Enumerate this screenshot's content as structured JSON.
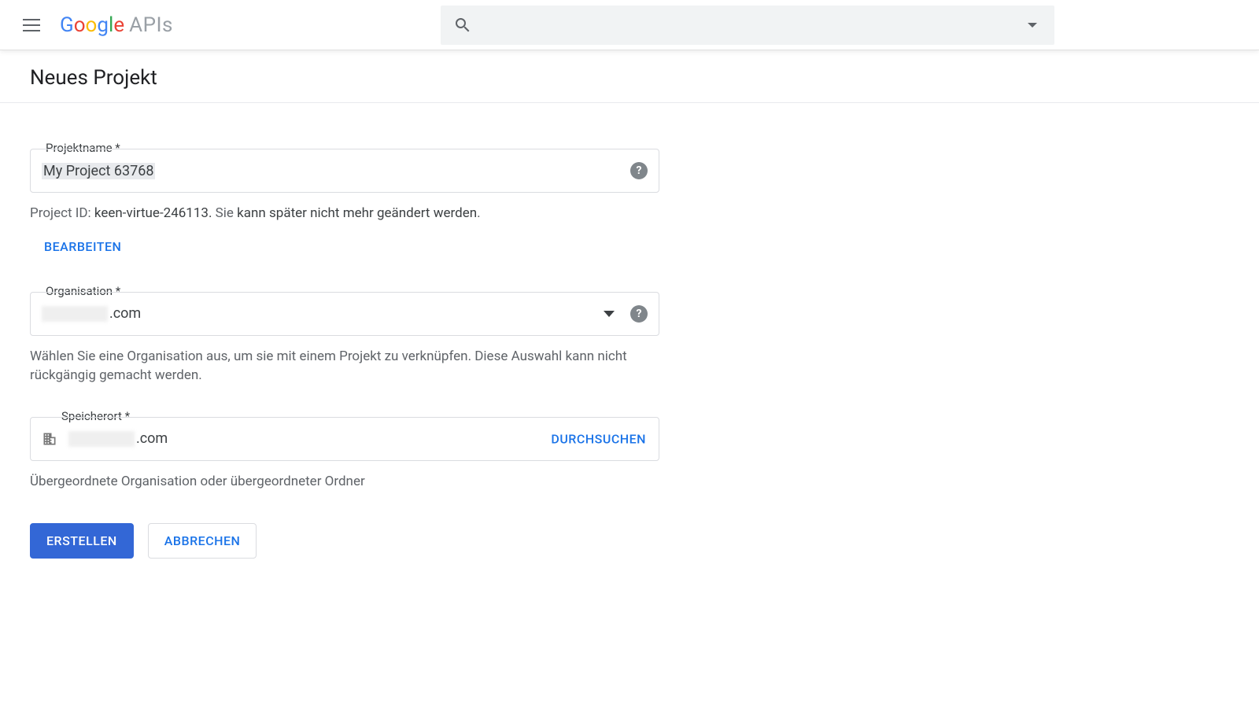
{
  "header": {
    "brand_g1": "G",
    "brand_o1": "o",
    "brand_o2": "o",
    "brand_g2": "g",
    "brand_l": "l",
    "brand_e": "e",
    "brand_apis": "APIs",
    "search_placeholder": ""
  },
  "page": {
    "title": "Neues Projekt"
  },
  "projectname": {
    "label": "Projektname *",
    "value": "My Project 63768",
    "note_prefix": "Project ID: ",
    "note_id": "keen-virtue-246113.",
    "note_rest_1": " Sie ",
    "note_rest_bold": "kann später nicht mehr geändert werden",
    "note_rest_2": ".",
    "edit": "BEARBEITEN"
  },
  "organisation": {
    "label": "Organisation *",
    "value_suffix": ".com",
    "note": "Wählen Sie eine Organisation aus, um sie mit einem Projekt zu verknüpfen. Diese Auswahl kann nicht rückgängig gemacht werden."
  },
  "location": {
    "label": "Speicherort *",
    "value_suffix": ".com",
    "browse": "DURCHSUCHEN",
    "note": "Übergeordnete Organisation oder übergeordneter Ordner"
  },
  "buttons": {
    "create": "ERSTELLEN",
    "cancel": "ABBRECHEN"
  }
}
